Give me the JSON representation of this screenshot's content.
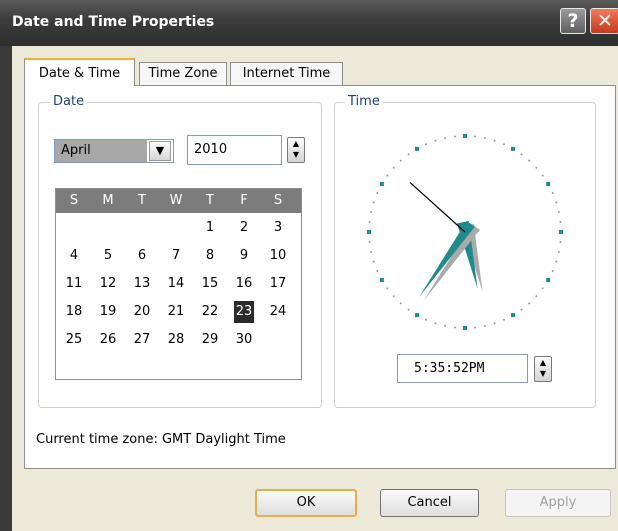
{
  "window": {
    "title": "Date and Time Properties",
    "help_label": "?",
    "close_label": "✕"
  },
  "tabs": [
    {
      "label": "Date & Time",
      "active": true
    },
    {
      "label": "Time Zone",
      "active": false
    },
    {
      "label": "Internet Time",
      "active": false
    }
  ],
  "date_group": {
    "label": "Date",
    "month": "April",
    "year": "2010",
    "weekdays": [
      "S",
      "M",
      "T",
      "W",
      "T",
      "F",
      "S"
    ],
    "weeks": [
      [
        "",
        "",
        "",
        "",
        "1",
        "2",
        "3"
      ],
      [
        "4",
        "5",
        "6",
        "7",
        "8",
        "9",
        "10"
      ],
      [
        "11",
        "12",
        "13",
        "14",
        "15",
        "16",
        "17"
      ],
      [
        "18",
        "19",
        "20",
        "21",
        "22",
        "23",
        "24"
      ],
      [
        "25",
        "26",
        "27",
        "28",
        "29",
        "30",
        ""
      ]
    ],
    "selected_day": "23"
  },
  "time_group": {
    "label": "Time",
    "time": "5:35:52PM",
    "clock": {
      "hour": 5,
      "minute": 35,
      "second": 52
    }
  },
  "timezone": {
    "text": "Current time zone:  GMT Daylight Time"
  },
  "buttons": {
    "ok": "OK",
    "cancel": "Cancel",
    "apply": "Apply"
  },
  "colors": {
    "titlebar": "#3b3b3b",
    "accent": "#f0b040",
    "clock_hands": "#1e8c8c",
    "calendar_header": "#7c7c7c"
  }
}
